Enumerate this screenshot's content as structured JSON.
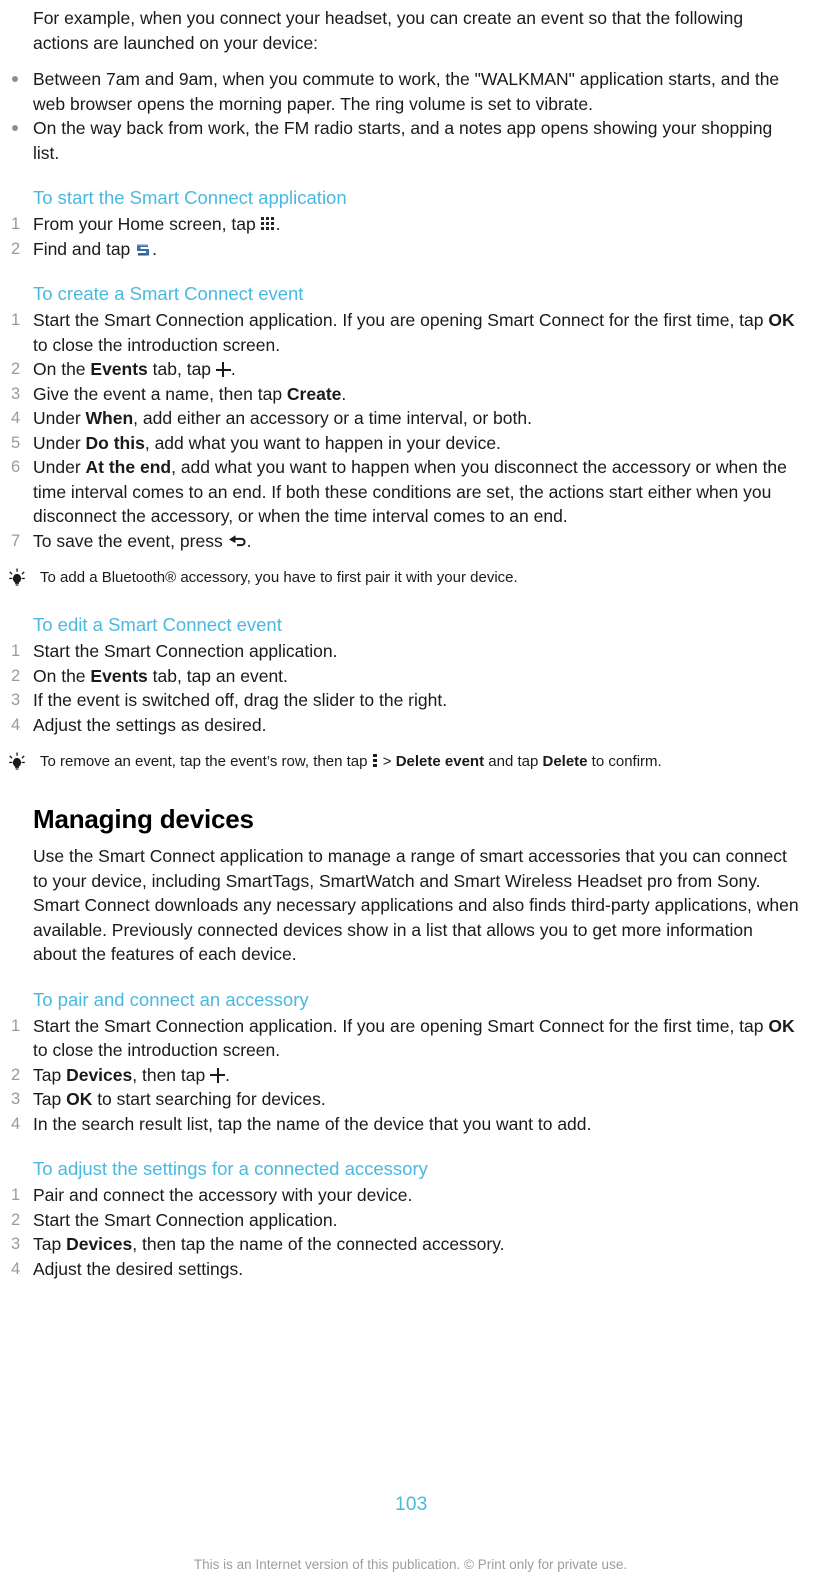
{
  "document": {
    "page_number": "103",
    "footer_note": "This is an Internet version of this publication. © Print only for private use.",
    "accent_color": "#49b9e0",
    "text_color": "#1a1a1a",
    "number_color": "#9a9a9a"
  },
  "intro": {
    "paragraph": "For example, when you connect your headset, you can create an event so that the following actions are launched on your device:",
    "bullets": [
      "Between 7am and 9am, when you commute to work, the \"WALKMAN\" application starts, and the web browser opens the morning paper. The ring volume is set to vibrate.",
      "On the way back from work, the FM radio starts, and a notes app opens showing your shopping list."
    ]
  },
  "start_app": {
    "heading": "To start the Smart Connect application",
    "steps": [
      {
        "num": "1",
        "pre": "From your Home screen, tap ",
        "icon": "app-grid-icon",
        "post": "."
      },
      {
        "num": "2",
        "pre": "Find and tap ",
        "icon": "smart-connect-icon",
        "post": "."
      }
    ]
  },
  "create_event": {
    "heading": "To create a Smart Connect event",
    "steps": [
      {
        "num": "1",
        "pre": "Start the Smart Connection application. If you are opening Smart Connect for the first time, tap ",
        "bold": "OK",
        "post": " to close the introduction screen."
      },
      {
        "num": "2",
        "pre": "On the ",
        "bold": "Events",
        "mid": " tab, tap ",
        "icon": "plus-icon",
        "post": "."
      },
      {
        "num": "3",
        "pre": "Give the event a name, then tap ",
        "bold": "Create",
        "post": "."
      },
      {
        "num": "4",
        "pre": "Under ",
        "bold": "When",
        "post": ", add either an accessory or a time interval, or both."
      },
      {
        "num": "5",
        "pre": "Under ",
        "bold": "Do this",
        "post": ", add what you want to happen in your device."
      },
      {
        "num": "6",
        "pre": "Under ",
        "bold": "At the end",
        "post": ", add what you want to happen when you disconnect the accessory or when the time interval comes to an end. If both these conditions are set, the actions start either when you disconnect the accessory, or when the time interval comes to an end."
      },
      {
        "num": "7",
        "pre": "To save the event, press ",
        "icon": "back-arrow-icon",
        "post": "."
      }
    ],
    "tip": "To add a Bluetooth® accessory, you have to first pair it with your device."
  },
  "edit_event": {
    "heading": "To edit a Smart Connect event",
    "steps": [
      {
        "num": "1",
        "pre": "Start the Smart Connection application."
      },
      {
        "num": "2",
        "pre": "On the ",
        "bold": "Events",
        "post": " tab, tap an event."
      },
      {
        "num": "3",
        "pre": "If the event is switched off, drag the slider to the right."
      },
      {
        "num": "4",
        "pre": "Adjust the settings as desired."
      }
    ],
    "tip_pre": "To remove an event, tap the event’s row, then tap ",
    "tip_icon": "kebab-menu-icon",
    "tip_mid": " > ",
    "tip_bold1": "Delete event",
    "tip_mid2": " and tap ",
    "tip_bold2": "Delete",
    "tip_post": " to confirm."
  },
  "managing_devices": {
    "heading": "Managing devices",
    "paragraph": "Use the Smart Connect application to manage a range of smart accessories that you can connect to your device, including SmartTags, SmartWatch and Smart Wireless Headset pro from Sony. Smart Connect downloads any necessary applications and also finds third-party applications, when available. Previously connected devices show in a list that allows you to get more information about the features of each device."
  },
  "pair_accessory": {
    "heading": "To pair and connect an accessory",
    "steps": [
      {
        "num": "1",
        "pre": "Start the Smart Connection application. If you are opening Smart Connect for the first time, tap ",
        "bold": "OK",
        "post": " to close the introduction screen."
      },
      {
        "num": "2",
        "pre": "Tap ",
        "bold": "Devices",
        "mid": ", then tap ",
        "icon": "plus-icon",
        "post": "."
      },
      {
        "num": "3",
        "pre": "Tap ",
        "bold": "OK",
        "post": " to start searching for devices."
      },
      {
        "num": "4",
        "pre": "In the search result list, tap the name of the device that you want to add."
      }
    ]
  },
  "adjust_settings": {
    "heading": "To adjust the settings for a connected accessory",
    "steps": [
      {
        "num": "1",
        "pre": "Pair and connect the accessory with your device."
      },
      {
        "num": "2",
        "pre": "Start the Smart Connection application."
      },
      {
        "num": "3",
        "pre": "Tap ",
        "bold": "Devices",
        "post": ", then tap the name of the connected accessory."
      },
      {
        "num": "4",
        "pre": "Adjust the desired settings."
      }
    ]
  }
}
